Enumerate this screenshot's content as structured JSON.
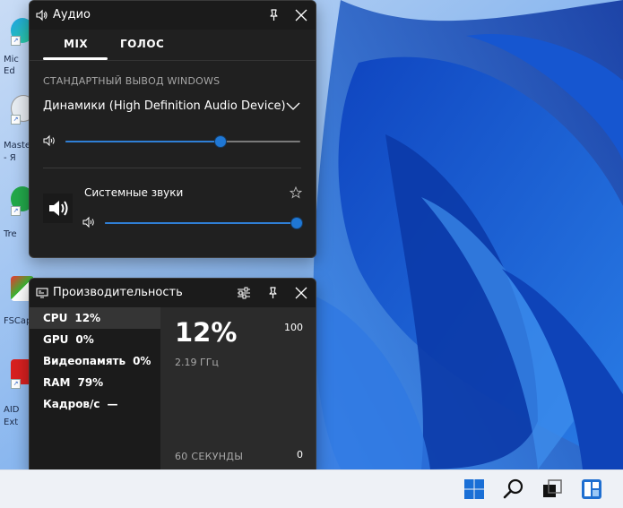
{
  "audio": {
    "title": "Аудио",
    "tabs": [
      {
        "label": "MIX",
        "active": true
      },
      {
        "label": "ГОЛОС",
        "active": false
      }
    ],
    "section_label": "СТАНДАРТНЫЙ ВЫВОД WINDOWS",
    "device": {
      "name": "Динамики (High Definition Audio Device)",
      "volume_percent": 66
    },
    "apps": [
      {
        "name": "Системные звуки",
        "volume_percent": 100,
        "icon": "speaker-icon"
      }
    ]
  },
  "performance": {
    "title": "Производительность",
    "metrics": [
      {
        "key": "CPU",
        "value": "12%",
        "active": true
      },
      {
        "key": "GPU",
        "value": "0%",
        "active": false
      },
      {
        "key": "Видеопамять",
        "value": "0%",
        "active": false
      },
      {
        "key": "RAM",
        "value": "79%",
        "active": false
      },
      {
        "key": "Кадров/с",
        "value": "—",
        "active": false
      }
    ],
    "detail": {
      "value": "12%",
      "frequency": "2.19 ГГц",
      "y_max": "100",
      "y_min": "0",
      "x_label": "60 СЕКУНДЫ"
    }
  },
  "desktop": {
    "icons": [
      {
        "label": "Mic",
        "label2": "Ed",
        "icon": "edge-icon"
      },
      {
        "label": "Maste",
        "label2": "- Я",
        "icon": "master-icon"
      },
      {
        "label": "Tre",
        "label2": "",
        "icon": "tree-icon"
      },
      {
        "label": "FSCap",
        "label2": "",
        "icon": "fscapture-icon"
      },
      {
        "label": "AID",
        "label2": "Ext",
        "icon": "aida-icon"
      }
    ]
  },
  "colors": {
    "panel_bg": "#202020",
    "accent": "#1f77d4",
    "wallpaper": "#1d5fd1"
  }
}
